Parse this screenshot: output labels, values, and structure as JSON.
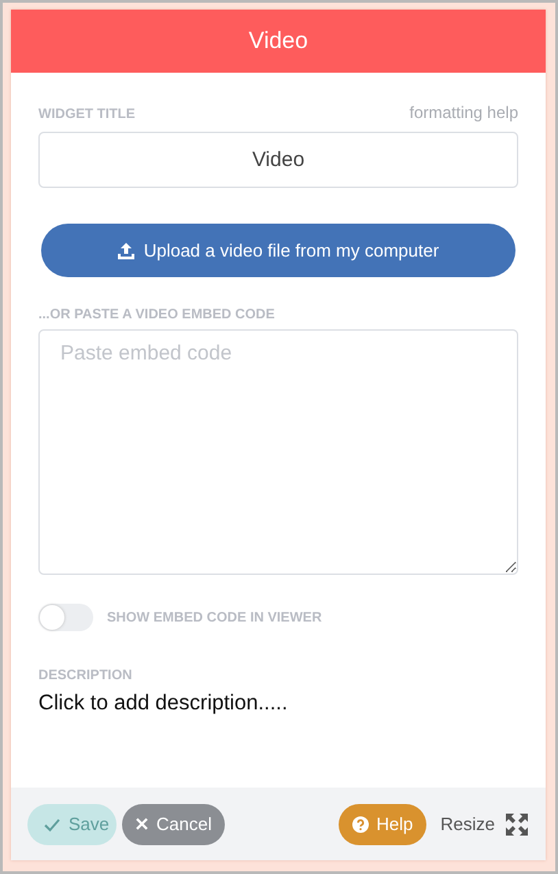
{
  "header": {
    "title": "Video"
  },
  "widget_title": {
    "label": "WIDGET TITLE",
    "help_link": "formatting help",
    "value": "Video"
  },
  "upload_button": {
    "label": "Upload a video file from my computer"
  },
  "embed": {
    "label": "...OR PASTE A VIDEO EMBED CODE",
    "placeholder": "Paste embed code"
  },
  "toggle": {
    "label": "SHOW EMBED CODE IN VIEWER",
    "on": false
  },
  "description": {
    "label": "DESCRIPTION",
    "text": "Click to add description....."
  },
  "footer": {
    "buttons": [
      {
        "kind": "save",
        "label": "Save",
        "disabled": true
      },
      {
        "kind": "cancel",
        "label": "Cancel",
        "disabled": false
      },
      {
        "kind": "help",
        "label": "Help",
        "disabled": false
      },
      {
        "kind": "resize",
        "label": "Resize",
        "disabled": false
      }
    ]
  }
}
